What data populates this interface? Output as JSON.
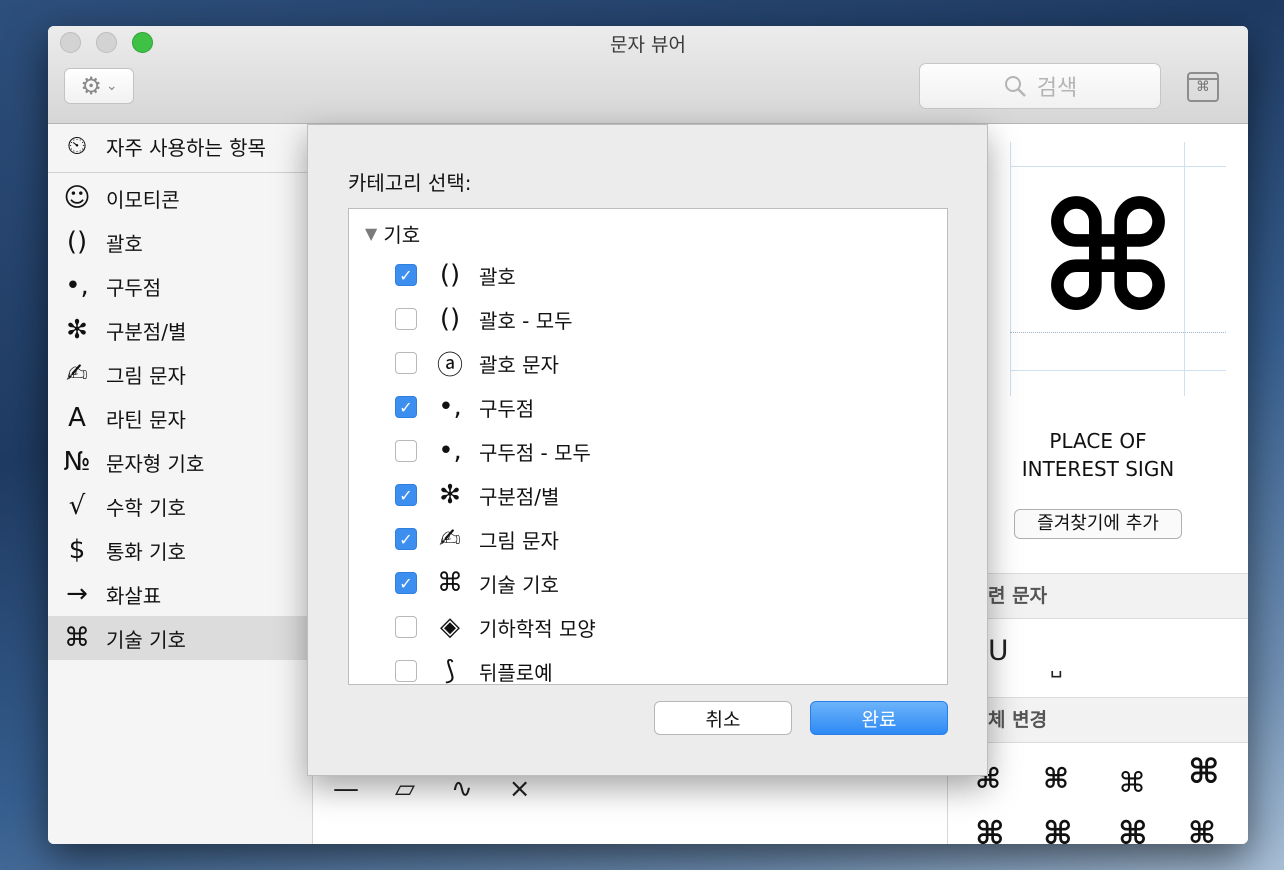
{
  "window": {
    "title": "문자 뷰어"
  },
  "toolbar": {
    "gear_icon": "gear-icon",
    "search_placeholder": "검색"
  },
  "sidebar": {
    "items": [
      {
        "icon": "⏲",
        "label": "자주 사용하는 항목"
      },
      {
        "icon": "☺",
        "label": "이모티콘"
      },
      {
        "icon": "()",
        "label": "괄호"
      },
      {
        "icon": "•,",
        "label": "구두점"
      },
      {
        "icon": "✻",
        "label": "구분점/별"
      },
      {
        "icon": "✍",
        "label": "그림 문자"
      },
      {
        "icon": "A",
        "label": "라틴 문자"
      },
      {
        "icon": "№",
        "label": "문자형 기호"
      },
      {
        "icon": "√",
        "label": "수학 기호"
      },
      {
        "icon": "$",
        "label": "통화 기호"
      },
      {
        "icon": "→",
        "label": "화살표"
      },
      {
        "icon": "⌘",
        "label": "기술 기호",
        "selected": true
      }
    ]
  },
  "charlist": {
    "bottom_row": [
      "—",
      "▱",
      "∿",
      "⨯"
    ]
  },
  "detail": {
    "glyph": "⌘",
    "name_line1": "PLACE OF",
    "name_line2": "INTEREST SIGN",
    "fav_button": "즐겨찾기에 추가",
    "related_header": "련 문자",
    "related_chars": [
      "ᑌ",
      "␣"
    ],
    "variants_header": "체 변경",
    "variants": [
      "⌘",
      "⌘",
      "⌘",
      "⌘",
      "⌘",
      "⌘",
      "⌘",
      "⌘"
    ]
  },
  "sheet": {
    "title": "카테고리 선택:",
    "group_label": "기호",
    "items": [
      {
        "icon": "()",
        "label": "괄호",
        "checked": true
      },
      {
        "icon": "()",
        "label": "괄호 - 모두",
        "checked": false
      },
      {
        "icon": "ⓐ",
        "label": "괄호 문자",
        "checked": false
      },
      {
        "icon": "•,",
        "label": "구두점",
        "checked": true
      },
      {
        "icon": "•,",
        "label": "구두점 - 모두",
        "checked": false
      },
      {
        "icon": "✻",
        "label": "구분점/별",
        "checked": true
      },
      {
        "icon": "✍",
        "label": "그림 문자",
        "checked": true
      },
      {
        "icon": "⌘",
        "label": "기술 기호",
        "checked": true
      },
      {
        "icon": "◈",
        "label": "기하학적 모양",
        "checked": false
      },
      {
        "icon": "⟆",
        "label": "뒤플로예",
        "checked": false
      }
    ],
    "cancel_label": "취소",
    "done_label": "완료"
  }
}
